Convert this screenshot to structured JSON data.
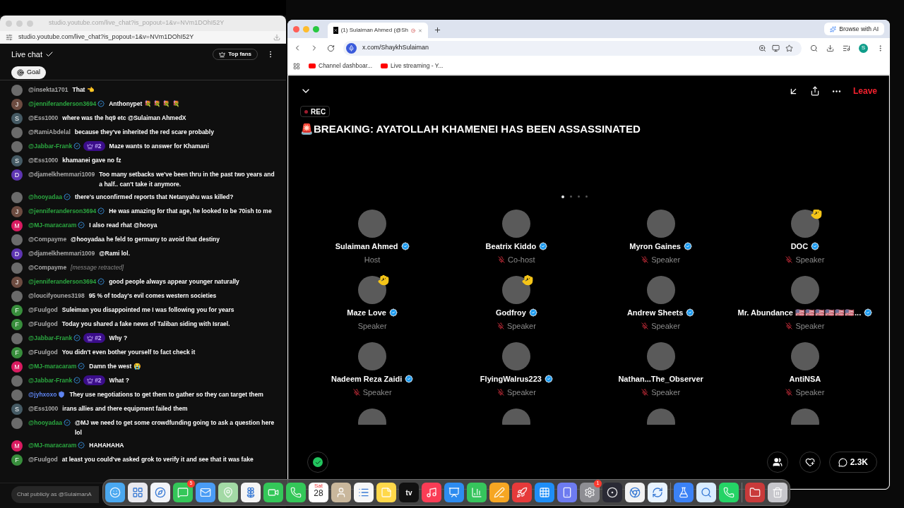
{
  "chat_window": {
    "title_url": "studio.youtube.com/live_chat?is_popout=1&v=NVm1DOhI52Y",
    "address": "studio.youtube.com/live_chat?is_popout=1&v=NVm1DOhI52Y",
    "header": "Live chat",
    "top_fans": "Top fans",
    "goal": "Goal",
    "messages": [
      {
        "avatar": {
          "kind": "photo"
        },
        "author": "@insekta1701",
        "kind": "viewer",
        "text": "That 👈"
      },
      {
        "avatar": {
          "kind": "letter",
          "letter": "J",
          "color": "#6d4c41"
        },
        "author": "@jenniferanderson3694",
        "kind": "member",
        "text": "Anthonypet 💐 💐 💐 💐"
      },
      {
        "avatar": {
          "kind": "letter",
          "letter": "S",
          "color": "#455a64"
        },
        "author": "@Ess1000",
        "kind": "viewer",
        "text": "where was the hq9 etc @Sulaiman AhmedX"
      },
      {
        "avatar": {
          "kind": "photo"
        },
        "author": "@RamiAbdelal",
        "kind": "viewer",
        "text": "because they've inherited the red scare probably"
      },
      {
        "avatar": {
          "kind": "photo"
        },
        "author": "@Jabbar-Frank",
        "kind": "member",
        "rank": "#2",
        "text": "Maze wants to answer for Khamani"
      },
      {
        "avatar": {
          "kind": "letter",
          "letter": "S",
          "color": "#455a64"
        },
        "author": "@Ess1000",
        "kind": "viewer",
        "text": "khamanei gave no fz"
      },
      {
        "avatar": {
          "kind": "letter",
          "letter": "D",
          "color": "#5e35b1"
        },
        "author": "@djamelkhemmari1009",
        "kind": "viewer",
        "text": "Too many setbacks we've been thru in the past two years and a half.. can't take it anymore."
      },
      {
        "avatar": {
          "kind": "photo"
        },
        "author": "@hooyadaa",
        "kind": "member",
        "text": "there's unconfirmed reports that Netanyahu was killed?"
      },
      {
        "avatar": {
          "kind": "letter",
          "letter": "J",
          "color": "#6d4c41"
        },
        "author": "@jenniferanderson3694",
        "kind": "member",
        "text": "He was amazing for that age, he looked to be 70ish to me"
      },
      {
        "avatar": {
          "kind": "letter",
          "letter": "M",
          "color": "#d81b60"
        },
        "author": "@MJ-maracaram",
        "kind": "member",
        "text": "I also read rhat @hooya"
      },
      {
        "avatar": {
          "kind": "photo"
        },
        "author": "@Compayme",
        "kind": "viewer",
        "text": "@hooyadaa he feld to germany to avoid that destiny"
      },
      {
        "avatar": {
          "kind": "letter",
          "letter": "D",
          "color": "#5e35b1"
        },
        "author": "@djamelkhemmari1009",
        "kind": "viewer",
        "text": "@Rami lol."
      },
      {
        "avatar": {
          "kind": "photo"
        },
        "author": "@Compayme",
        "kind": "viewer",
        "retracted": true,
        "text": "[message retracted]"
      },
      {
        "avatar": {
          "kind": "letter",
          "letter": "J",
          "color": "#6d4c41"
        },
        "author": "@jenniferanderson3694",
        "kind": "member",
        "text": "good people always appear younger naturally"
      },
      {
        "avatar": {
          "kind": "photo"
        },
        "author": "@loucifyounes3198",
        "kind": "viewer",
        "text": "95 % of today's evil comes western societies"
      },
      {
        "avatar": {
          "kind": "letter",
          "letter": "F",
          "color": "#388e3c"
        },
        "author": "@Fuulgod",
        "kind": "viewer",
        "text": "Suleiman you disappointed me I was following you for years"
      },
      {
        "avatar": {
          "kind": "letter",
          "letter": "F",
          "color": "#388e3c"
        },
        "author": "@Fuulgod",
        "kind": "viewer",
        "text": "Today you shared a fake news of Taliban siding with Israel."
      },
      {
        "avatar": {
          "kind": "photo"
        },
        "author": "@Jabbar-Frank",
        "kind": "member",
        "rank": "#2",
        "text": "Why ?"
      },
      {
        "avatar": {
          "kind": "letter",
          "letter": "F",
          "color": "#388e3c"
        },
        "author": "@Fuulgod",
        "kind": "viewer",
        "text": "You didn't even bother yourself to fact check it"
      },
      {
        "avatar": {
          "kind": "letter",
          "letter": "M",
          "color": "#d81b60"
        },
        "author": "@MJ-maracaram",
        "kind": "member",
        "text": "Damn the west 😭"
      },
      {
        "avatar": {
          "kind": "photo"
        },
        "author": "@Jabbar-Frank",
        "kind": "member",
        "rank": "#2",
        "text": "What ?"
      },
      {
        "avatar": {
          "kind": "photo"
        },
        "author": "@jyhxoxo",
        "kind": "moderator",
        "text": "They use negotiations to get them to gather so they can target them"
      },
      {
        "avatar": {
          "kind": "letter",
          "letter": "S",
          "color": "#455a64"
        },
        "author": "@Ess1000",
        "kind": "viewer",
        "text": "irans allies and there equipment failed them"
      },
      {
        "avatar": {
          "kind": "photo"
        },
        "author": "@hooyadaa",
        "kind": "member",
        "text": "@MJ we need to get some crowdfunding going to ask a question here lol"
      },
      {
        "avatar": {
          "kind": "letter",
          "letter": "M",
          "color": "#d81b60"
        },
        "author": "@MJ-maracaram",
        "kind": "member",
        "text": "HAHAHAHA"
      },
      {
        "avatar": {
          "kind": "letter",
          "letter": "F",
          "color": "#388e3c"
        },
        "author": "@Fuulgod",
        "kind": "viewer",
        "text": "at least you could've asked grok to verify it and see that it was fake"
      }
    ],
    "input": {
      "placeholder": "Chat publicly as @SulaimanA"
    }
  },
  "browser": {
    "tab": {
      "title": "(1) Sulaiman Ahmed (@Sh",
      "recording": true
    },
    "browse_ai": "Browse with AI",
    "address": "x.com/ShaykhSulaiman",
    "profile": "S",
    "bookmarks": [
      "Channel dashboar...",
      "Live streaming - Y..."
    ]
  },
  "space": {
    "leave": "Leave",
    "rec": "REC",
    "title": "🚨BREAKING: AYATOLLAH KHAMENEI HAS BEEN ASSASSINATED",
    "pages": [
      {
        "selected": true
      },
      {
        "selected": false
      },
      {
        "selected": false
      },
      {
        "selected": false
      }
    ],
    "speakers": [
      {
        "name": "Sulaiman Ahmed",
        "verified": true,
        "role": "Host",
        "muted": false,
        "hand_raised": false
      },
      {
        "name": "Beatrix Kiddo",
        "verified": true,
        "role": "Co-host",
        "muted": true,
        "hand_raised": false
      },
      {
        "name": "Myron Gaines",
        "verified": true,
        "role": "Speaker",
        "muted": true,
        "hand_raised": false
      },
      {
        "name": "DOC",
        "verified": true,
        "role": "Speaker",
        "muted": true,
        "hand_raised": true
      },
      {
        "name": "Maze Love",
        "verified": true,
        "role": "Speaker",
        "muted": false,
        "hand_raised": true
      },
      {
        "name": "Godfroy",
        "verified": true,
        "role": "Speaker",
        "muted": true,
        "hand_raised": true
      },
      {
        "name": "Andrew Sheets",
        "verified": true,
        "role": "Speaker",
        "muted": true,
        "hand_raised": false
      },
      {
        "name": "Mr. Abundance 🇺🇸🇺🇸🇺🇸🇺🇸🇺🇸🇺🇸...",
        "verified": true,
        "role": "Speaker",
        "muted": true,
        "hand_raised": false
      },
      {
        "name": "Nadeem Reza Zaidi",
        "verified": true,
        "role": "Speaker",
        "muted": true,
        "hand_raised": false
      },
      {
        "name": "FlyingWalrus223",
        "verified": true,
        "role": "Speaker",
        "muted": true,
        "hand_raised": false
      },
      {
        "name": "Nathan...The_Observer",
        "verified": false,
        "role": "Speaker",
        "muted": true,
        "hand_raised": false
      },
      {
        "name": "AntiNSA",
        "verified": false,
        "role": "Speaker",
        "muted": true,
        "hand_raised": false
      }
    ],
    "listeners_count": "2.3K"
  },
  "dock": [
    {
      "kind": "finder"
    },
    {
      "kind": "launchpad"
    },
    {
      "kind": "safari"
    },
    {
      "kind": "messages",
      "badge": "5"
    },
    {
      "kind": "mail"
    },
    {
      "kind": "maps"
    },
    {
      "kind": "photos"
    },
    {
      "kind": "facetime"
    },
    {
      "kind": "phone"
    },
    {
      "kind": "calendar",
      "weekday": "Sat",
      "day": "28"
    },
    {
      "kind": "contacts"
    },
    {
      "kind": "reminders"
    },
    {
      "kind": "notes"
    },
    {
      "kind": "tv",
      "label": "tv"
    },
    {
      "kind": "music"
    },
    {
      "kind": "keynote"
    },
    {
      "kind": "numbers"
    },
    {
      "kind": "pages"
    },
    {
      "kind": "rocket"
    },
    {
      "kind": "appstore"
    },
    {
      "kind": "device"
    },
    {
      "kind": "settings",
      "badge": "1"
    },
    {
      "kind": "obs"
    },
    {
      "kind": "chrome"
    },
    {
      "kind": "sync"
    },
    {
      "kind": "separator"
    },
    {
      "kind": "jar"
    },
    {
      "kind": "quicktime"
    },
    {
      "kind": "whatsapp"
    },
    {
      "kind": "separator"
    },
    {
      "kind": "folder"
    },
    {
      "kind": "trash"
    }
  ]
}
